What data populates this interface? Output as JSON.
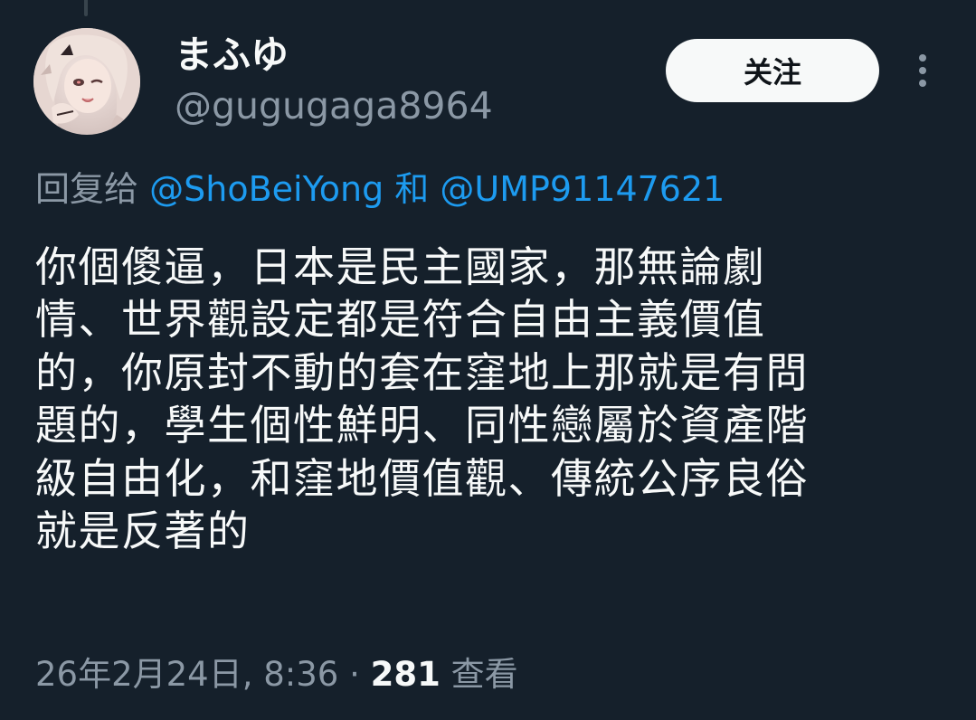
{
  "author": {
    "display_name": "まふゆ",
    "handle": "@gugugaga8964"
  },
  "follow_button": {
    "label": "关注"
  },
  "more_menu": {
    "icon": "more-vertical-icon"
  },
  "reply_context": {
    "prefix": "回复给",
    "mention_1": "@ShoBeiYong",
    "joiner": "和",
    "mention_2": "@UMP91147621"
  },
  "tweet": {
    "lines": [
      "你個傻逼，日本是民主國家，那無論劇",
      "情、世界觀設定都是符合自由主義價值",
      "的，你原封不動的套在窪地上那就是有問",
      "題的，學生個性鮮明、同性戀屬於資產階",
      "級自由化，和窪地價值觀、傳統公序良俗",
      "就是反著的"
    ]
  },
  "meta": {
    "timestamp": "26年2月24日, 8:36",
    "separator": "·",
    "views_count": "281",
    "views_label": "查看"
  },
  "colors": {
    "background": "#15202b",
    "text_primary": "#f7f9f9",
    "text_secondary": "#8b98a5",
    "link": "#1d9bf0",
    "button_bg": "#f7f9f9",
    "button_text": "#0f1419"
  }
}
